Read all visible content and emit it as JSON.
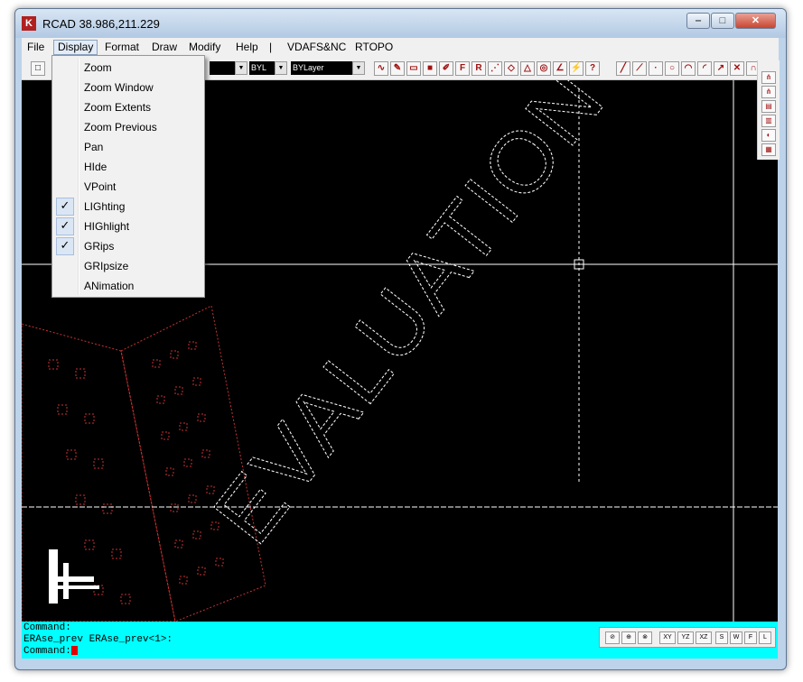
{
  "window": {
    "title": "RCAD  38.986,211.229",
    "min_glyph": "‒",
    "max_glyph": "□",
    "close_glyph": "✕"
  },
  "menubar": {
    "items": [
      "File",
      "Display",
      "Format",
      "Draw",
      "Modify",
      "Help",
      "|",
      "VDAFS&NC",
      "RTOPO"
    ],
    "active": "Display"
  },
  "toolbar": {
    "combo_linetype": "BYL",
    "combo_layer": "BYLayer"
  },
  "display_menu": {
    "items": [
      {
        "label": "Zoom",
        "checked": false
      },
      {
        "label": "Zoom Window",
        "checked": false
      },
      {
        "label": "Zoom Extents",
        "checked": false
      },
      {
        "label": "Zoom Previous",
        "checked": false
      },
      {
        "label": "Pan",
        "checked": false
      },
      {
        "label": "HIde",
        "checked": false
      },
      {
        "label": "VPoint",
        "checked": false
      },
      {
        "label": "LIGhting",
        "checked": true
      },
      {
        "label": "HIGhlight",
        "checked": true
      },
      {
        "label": "GRips",
        "checked": true
      },
      {
        "label": "GRIpsize",
        "checked": false
      },
      {
        "label": "ANimation",
        "checked": false
      }
    ],
    "check_glyph": "✓"
  },
  "canvas": {
    "watermark_text": "EVALUATION",
    "background": "#000000",
    "crosshair_color": "#ffffff",
    "building_color": "#c83232"
  },
  "command": {
    "line1": "Command:",
    "line2": "ERAse_prev ERAse_prev<1>:",
    "line3": "Command:",
    "background": "#00ffff"
  },
  "status": {
    "buttons": [
      "XY",
      "YZ",
      "XZ",
      "S",
      "W",
      "F",
      "L"
    ]
  }
}
